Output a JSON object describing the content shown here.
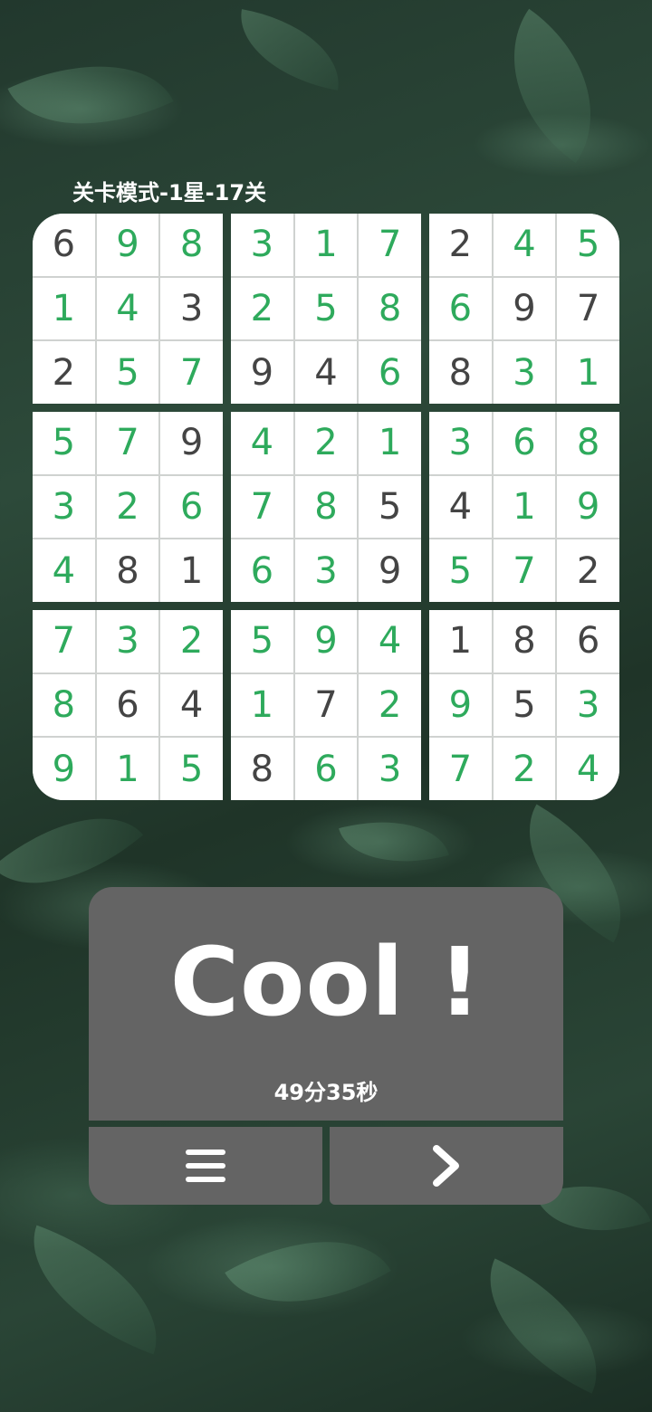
{
  "header": {
    "level_title": "关卡模式-1星-17关"
  },
  "board": {
    "rows": [
      [
        "6",
        "9",
        "8",
        "3",
        "1",
        "7",
        "2",
        "4",
        "5"
      ],
      [
        "1",
        "4",
        "3",
        "2",
        "5",
        "8",
        "6",
        "9",
        "7"
      ],
      [
        "2",
        "5",
        "7",
        "9",
        "4",
        "6",
        "8",
        "3",
        "1"
      ],
      [
        "5",
        "7",
        "9",
        "4",
        "2",
        "1",
        "3",
        "6",
        "8"
      ],
      [
        "3",
        "2",
        "6",
        "7",
        "8",
        "5",
        "4",
        "1",
        "9"
      ],
      [
        "4",
        "8",
        "1",
        "6",
        "3",
        "9",
        "5",
        "7",
        "2"
      ],
      [
        "7",
        "3",
        "2",
        "5",
        "9",
        "4",
        "1",
        "8",
        "6"
      ],
      [
        "8",
        "6",
        "4",
        "1",
        "7",
        "2",
        "9",
        "5",
        "3"
      ],
      [
        "9",
        "1",
        "5",
        "8",
        "6",
        "3",
        "7",
        "2",
        "4"
      ]
    ],
    "given_mask": [
      [
        1,
        0,
        0,
        0,
        0,
        0,
        1,
        0,
        0
      ],
      [
        0,
        0,
        1,
        0,
        0,
        0,
        0,
        1,
        1
      ],
      [
        1,
        0,
        0,
        1,
        1,
        0,
        1,
        0,
        0
      ],
      [
        0,
        0,
        1,
        0,
        0,
        0,
        0,
        0,
        0
      ],
      [
        0,
        0,
        0,
        0,
        0,
        1,
        1,
        0,
        0
      ],
      [
        0,
        1,
        1,
        0,
        0,
        1,
        0,
        0,
        1
      ],
      [
        0,
        0,
        0,
        0,
        0,
        0,
        1,
        1,
        1
      ],
      [
        0,
        1,
        1,
        0,
        1,
        0,
        0,
        1,
        0
      ],
      [
        0,
        0,
        0,
        1,
        0,
        0,
        0,
        0,
        0
      ]
    ],
    "colors": {
      "given": "#444444",
      "user": "#2eaa5c",
      "cell_bg": "#ffffff",
      "grid_line": "#cfd2d0"
    }
  },
  "result": {
    "message": "Cool !",
    "time": "49分35秒",
    "panel_color": "#646464"
  },
  "buttons": {
    "menu_icon": "menu-icon",
    "next_icon": "chevron-right-icon"
  }
}
